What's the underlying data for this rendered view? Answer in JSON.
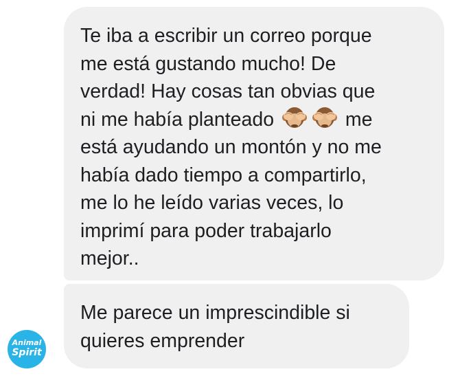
{
  "conversation": {
    "messages": [
      {
        "lines": [
          "Te iba a escribir un correo porque",
          "me está gustando mucho! De",
          "verdad! Hay cosas tan obvias que",
          "ni me había planteado",
          "me",
          "está ayudando un montón y no me",
          "había dado tiempo a compartirlo,",
          "me lo he leído varias veces, lo",
          "imprimí para poder trabajarlo",
          "mejor.."
        ],
        "emojis": [
          "see-no-evil-monkey",
          "see-no-evil-monkey"
        ]
      },
      {
        "lines": [
          "Me parece un imprescindible si",
          "quieres emprender"
        ]
      }
    ],
    "sender_avatar": {
      "line1": "Animal",
      "line2": "Spirit",
      "color": "#2ab3e6"
    }
  },
  "colors": {
    "bubble_background": "#f0f0f0",
    "text": "#1c1e21"
  }
}
